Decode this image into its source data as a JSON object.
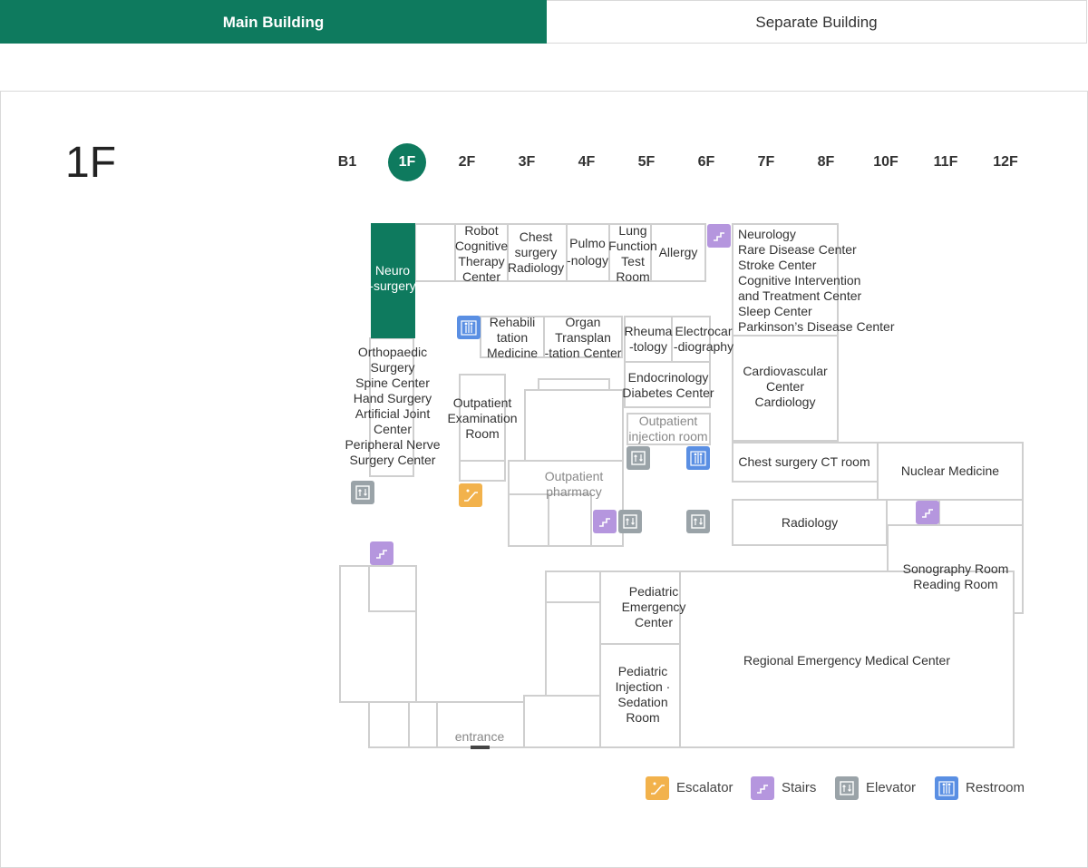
{
  "tabs": {
    "main": "Main Building",
    "separate": "Separate Building"
  },
  "floor": {
    "current": "1F",
    "buttons": [
      "B1",
      "1F",
      "2F",
      "3F",
      "4F",
      "5F",
      "6F",
      "7F",
      "8F",
      "10F",
      "11F",
      "12F"
    ],
    "active_index": 1
  },
  "map": {
    "rooms": {
      "neurosurgery": [
        "Neuro",
        "-surgery"
      ],
      "robot": [
        "Robot",
        "Cognitive",
        "Therapy",
        "Center"
      ],
      "chest_radiology": [
        "Chest",
        "surgery",
        "Radiology"
      ],
      "pulmonology": [
        "Pulmo",
        "-nology"
      ],
      "lung": [
        "Lung",
        "Function",
        "Test",
        "Room"
      ],
      "allergy": [
        "Allergy"
      ],
      "neurology": [
        "Neurology",
        "Rare Disease Center",
        "Stroke Center",
        "Cognitive Intervention",
        "and Treatment Center",
        "Sleep Center",
        "Parkinson’s Disease Center"
      ],
      "rehab": [
        "Rehabili",
        "tation",
        "Medicine"
      ],
      "organ": [
        "Organ",
        "Transplan",
        "-tation Center"
      ],
      "rheuma": [
        "Rheuma",
        "-tology"
      ],
      "electro": [
        "Electrocar",
        "-diography"
      ],
      "endo": [
        "Endocrinology",
        "Diabetes Center"
      ],
      "cardio": [
        "Cardiovascular",
        "Center",
        "Cardiology"
      ],
      "ortho": [
        "Orthopaedic",
        "Surgery",
        "Spine Center",
        "Hand Surgery",
        "Artificial Joint",
        "Center",
        "Peripheral Nerve",
        "Surgery Center"
      ],
      "outpatient_exam": [
        "Outpatient",
        "Examination",
        "Room"
      ],
      "injection": [
        "Outpatient",
        "injection room"
      ],
      "pharmacy": [
        "Outpatient",
        "pharmacy"
      ],
      "chest_ct": [
        "Chest surgery CT room"
      ],
      "nuclear": [
        "Nuclear Medicine"
      ],
      "radiology": [
        "Radiology"
      ],
      "sonography": [
        "Sonography Room",
        "Reading Room"
      ],
      "pediatric_er": [
        "Pediatric",
        "Emergency",
        "Center"
      ],
      "pediatric_injection": [
        "Pediatric",
        "Injection ·",
        "Sedation",
        "Room"
      ],
      "regional_er": [
        "Regional Emergency Medical Center"
      ],
      "entrance": [
        "entrance"
      ]
    }
  },
  "legend": {
    "escalator": "Escalator",
    "stairs": "Stairs",
    "elevator": "Elevator",
    "restroom": "Restroom"
  },
  "colors": {
    "primary": "#0e7a5e",
    "escalator": "#f2b24c",
    "stairs": "#b596de",
    "elevator": "#9aa3a8",
    "restroom": "#5a8fe3",
    "wall": "#cfcfcf"
  }
}
